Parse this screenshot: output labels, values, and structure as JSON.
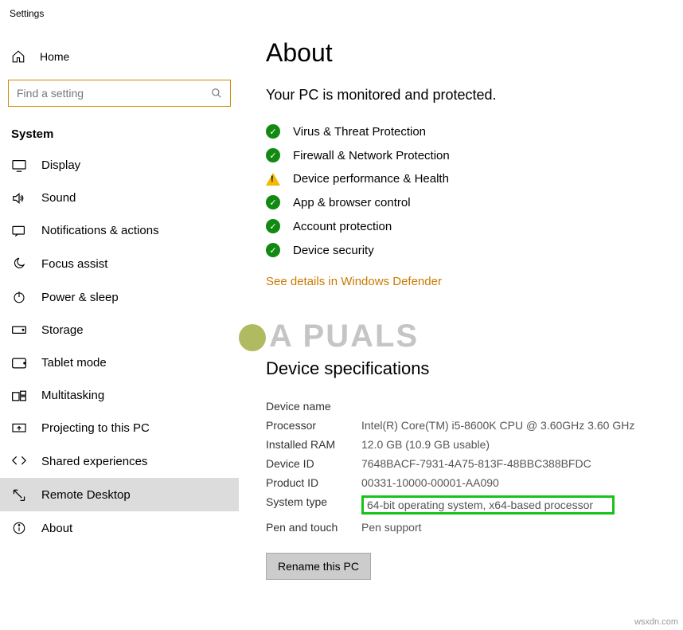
{
  "window": {
    "title": "Settings"
  },
  "sidebar": {
    "home": "Home",
    "search_placeholder": "Find a setting",
    "group": "System",
    "items": [
      {
        "label": "Display"
      },
      {
        "label": "Sound"
      },
      {
        "label": "Notifications & actions"
      },
      {
        "label": "Focus assist"
      },
      {
        "label": "Power & sleep"
      },
      {
        "label": "Storage"
      },
      {
        "label": "Tablet mode"
      },
      {
        "label": "Multitasking"
      },
      {
        "label": "Projecting to this PC"
      },
      {
        "label": "Shared experiences"
      },
      {
        "label": "Remote Desktop"
      },
      {
        "label": "About"
      }
    ]
  },
  "about": {
    "title": "About",
    "protection_heading": "Your PC is monitored and protected.",
    "status": [
      {
        "label": "Virus & Threat Protection",
        "state": "ok"
      },
      {
        "label": "Firewall & Network Protection",
        "state": "ok"
      },
      {
        "label": "Device performance & Health",
        "state": "warn"
      },
      {
        "label": "App & browser control",
        "state": "ok"
      },
      {
        "label": "Account protection",
        "state": "ok"
      },
      {
        "label": "Device security",
        "state": "ok"
      }
    ],
    "defender_link": "See details in Windows Defender",
    "specs_heading": "Device specifications",
    "specs": {
      "device_name_label": "Device name",
      "device_name_value": "",
      "processor_label": "Processor",
      "processor_value": "Intel(R) Core(TM) i5-8600K CPU @ 3.60GHz   3.60 GHz",
      "ram_label": "Installed RAM",
      "ram_value": "12.0 GB (10.9 GB usable)",
      "device_id_label": "Device ID",
      "device_id_value": "7648BACF-7931-4A75-813F-48BBC388BFDC",
      "product_id_label": "Product ID",
      "product_id_value": "00331-10000-00001-AA090",
      "system_type_label": "System type",
      "system_type_value": "64-bit operating system, x64-based processor",
      "pen_label": "Pen and touch",
      "pen_value": "Pen support"
    },
    "rename_button": "Rename this PC"
  },
  "watermark": "A  PUALS",
  "credit": "wsxdn.com"
}
